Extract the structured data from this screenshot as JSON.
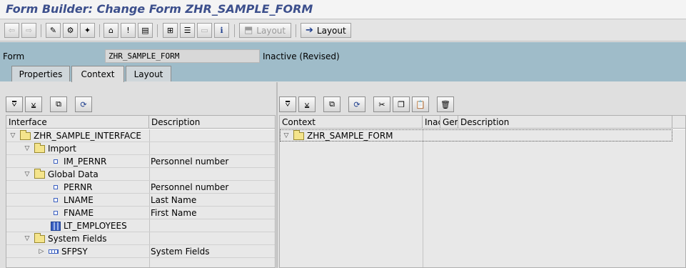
{
  "window": {
    "title": "Form Builder: Change Form ZHR_SAMPLE_FORM"
  },
  "toolbar": {
    "layout_disabled_label": "Layout",
    "layout_label": "Layout"
  },
  "header": {
    "form_label": "Form",
    "form_value": "ZHR_SAMPLE_FORM",
    "status": "Inactive (Revised)"
  },
  "tabs": [
    {
      "label": "Properties"
    },
    {
      "label": "Context"
    },
    {
      "label": "Layout"
    }
  ],
  "interface_grid": {
    "columns": [
      "Interface",
      "Description"
    ],
    "rows": [
      {
        "name": "ZHR_SAMPLE_INTERFACE",
        "description": ""
      },
      {
        "name": "Import",
        "description": ""
      },
      {
        "name": "IM_PERNR",
        "description": "Personnel number"
      },
      {
        "name": "Global Data",
        "description": ""
      },
      {
        "name": "PERNR",
        "description": "Personnel number"
      },
      {
        "name": "LNAME",
        "description": "Last Name"
      },
      {
        "name": "FNAME",
        "description": "First Name"
      },
      {
        "name": "LT_EMPLOYEES",
        "description": ""
      },
      {
        "name": "System Fields",
        "description": ""
      },
      {
        "name": "SFPSY",
        "description": "System Fields"
      }
    ]
  },
  "context_grid": {
    "columns": [
      "Context",
      "Inac",
      "Ger",
      "Description"
    ],
    "rows": [
      {
        "name": "ZHR_SAMPLE_FORM"
      }
    ]
  },
  "colors": {
    "header_bg": "#9fbcc9",
    "title_color": "#3c4f8c"
  }
}
